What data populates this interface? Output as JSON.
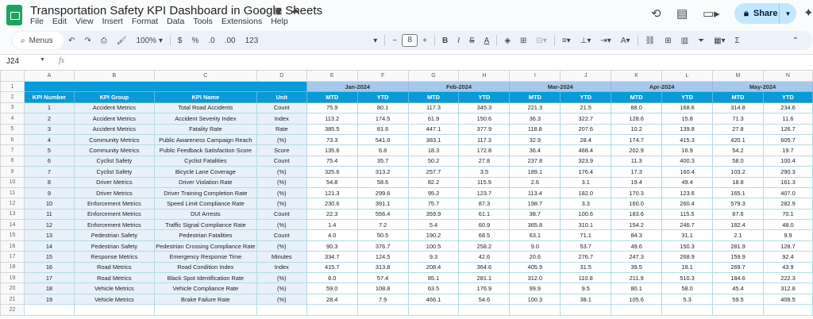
{
  "app": {
    "title": "Transportation Safety KPI Dashboard in Google Sheets",
    "menu": [
      "File",
      "Edit",
      "View",
      "Insert",
      "Format",
      "Data",
      "Tools",
      "Extensions",
      "Help"
    ],
    "share_label": "Share",
    "accent": "#1ea362"
  },
  "toolbar": {
    "search_label": "Menus",
    "zoom": "100%",
    "currency": "$",
    "percent": "%",
    "dec_less": ".0",
    "dec_more": ".00",
    "format_number": "123",
    "font_size": "8"
  },
  "formula_bar": {
    "cell_ref": "J24",
    "value": ""
  },
  "sheet": {
    "columns": [
      "A",
      "B",
      "C",
      "D",
      "E",
      "F",
      "G",
      "H",
      "I",
      "J",
      "K",
      "L",
      "M",
      "N"
    ],
    "selected_column": "J",
    "header_colors": {
      "main": "#0a9ad7",
      "month": "#a8c8ea",
      "label": "#e8f0fa"
    },
    "headers": [
      "KPI Number",
      "KPI Group",
      "KPI Name",
      "Unit"
    ],
    "months": [
      "Jan-2024",
      "Feb-2024",
      "Mar-2024",
      "Apr-2024",
      "May-2024"
    ],
    "sub_headers": [
      "MTD",
      "YTD"
    ],
    "rows": [
      [
        "1",
        "Accident Metrics",
        "Total Road Accidents",
        "Count",
        [
          "75.9",
          "80.1",
          "117.3",
          "345.3",
          "221.3",
          "21.5",
          "88.0",
          "168.6",
          "314.8",
          "234.6"
        ]
      ],
      [
        "2",
        "Accident Metrics",
        "Accident Severity Index",
        "Index",
        [
          "113.2",
          "174.5",
          "61.9",
          "150.6",
          "36.3",
          "322.7",
          "128.6",
          "15.8",
          "71.3",
          "11.6"
        ]
      ],
      [
        "3",
        "Accident Metrics",
        "Fatality Rate",
        "Rate",
        [
          "385.5",
          "81.6",
          "447.1",
          "377.9",
          "118.8",
          "207.6",
          "10.2",
          "139.8",
          "27.8",
          "126.7"
        ]
      ],
      [
        "4",
        "Community Metrics",
        "Public Awareness Campaign Reach",
        "(%)",
        [
          "73.3",
          "541.6",
          "383.1",
          "117.3",
          "32.9",
          "28.4",
          "174.7",
          "415.3",
          "420.1",
          "605.7"
        ]
      ],
      [
        "5",
        "Community Metrics",
        "Public Feedback Satisfaction Score",
        "Score",
        [
          "135.6",
          "6.8",
          "18.3",
          "172.8",
          "36.4",
          "468.4",
          "202.9",
          "16.9",
          "54.2",
          "19.7"
        ]
      ],
      [
        "6",
        "Cyclist Safety",
        "Cyclist Fatalities",
        "Count",
        [
          "75.4",
          "35.7",
          "50.2",
          "27.8",
          "237.8",
          "323.9",
          "11.3",
          "400.3",
          "58.0",
          "100.4"
        ]
      ],
      [
        "7",
        "Cyclist Safety",
        "Bicycle Lane Coverage",
        "(%)",
        [
          "325.6",
          "313.2",
          "257.7",
          "3.5",
          "189.1",
          "176.4",
          "17.3",
          "160.4",
          "103.2",
          "290.3"
        ]
      ],
      [
        "8",
        "Driver Metrics",
        "Driver Violation Rate",
        "(%)",
        [
          "54.8",
          "58.6",
          "82.2",
          "115.9",
          "2.6",
          "3.1",
          "19.4",
          "49.4",
          "18.8",
          "161.3"
        ]
      ],
      [
        "9",
        "Driver Metrics",
        "Driver Training Completion Rate",
        "(%)",
        [
          "121.3",
          "299.6",
          "95.2",
          "123.7",
          "113.4",
          "182.0",
          "170.3",
          "123.6",
          "165.1",
          "407.0"
        ]
      ],
      [
        "10",
        "Enforcement Metrics",
        "Speed Limit Compliance Rate",
        "(%)",
        [
          "230.6",
          "391.1",
          "75.7",
          "87.3",
          "198.7",
          "3.3",
          "160.0",
          "260.4",
          "579.3",
          "282.9"
        ]
      ],
      [
        "11",
        "Enforcement Metrics",
        "DUI Arrests",
        "Count",
        [
          "22.3",
          "556.4",
          "359.9",
          "61.1",
          "38.7",
          "100.6",
          "183.6",
          "115.5",
          "87.6",
          "70.1"
        ]
      ],
      [
        "12",
        "Enforcement Metrics",
        "Traffic Signal Compliance Rate",
        "(%)",
        [
          "1.4",
          "7.2",
          "5.4",
          "60.9",
          "365.8",
          "310.1",
          "154.2",
          "246.7",
          "182.4",
          "48.0"
        ]
      ],
      [
        "13",
        "Pedestrian Safety",
        "Pedestrian Fatalities",
        "Count",
        [
          "4.0",
          "50.5",
          "190.2",
          "68.5",
          "63.1",
          "71.1",
          "84.3",
          "31.1",
          "2.1",
          "9.9"
        ]
      ],
      [
        "14",
        "Pedestrian Safety",
        "Pedestrian Crossing Compliance Rate",
        "(%)",
        [
          "90.3",
          "376.7",
          "100.5",
          "258.2",
          "9.0",
          "53.7",
          "49.6",
          "150.3",
          "281.9",
          "128.7"
        ]
      ],
      [
        "15",
        "Response Metrics",
        "Emergency Response Time",
        "Minutes",
        [
          "334.7",
          "124.5",
          "9.3",
          "42.6",
          "20.6",
          "276.7",
          "247.3",
          "268.9",
          "159.9",
          "92.4"
        ]
      ],
      [
        "16",
        "Road Metrics",
        "Road Condition Index",
        "Index",
        [
          "415.7",
          "313.8",
          "208.4",
          "364.6",
          "405.9",
          "31.5",
          "39.5",
          "18.1",
          "269.7",
          "43.9"
        ]
      ],
      [
        "17",
        "Road Metrics",
        "Black Spot Identification Rate",
        "(%)",
        [
          "8.0",
          "57.4",
          "85.1",
          "281.1",
          "312.0",
          "110.8",
          "211.9",
          "510.3",
          "184.6",
          "222.3"
        ]
      ],
      [
        "18",
        "Vehicle Metrics",
        "Vehicle Compliance Rate",
        "(%)",
        [
          "59.0",
          "108.8",
          "63.5",
          "176.9",
          "99.9",
          "9.5",
          "80.1",
          "58.0",
          "45.4",
          "312.8"
        ]
      ],
      [
        "19",
        "Vehicle Metrics",
        "Brake Failure Rate",
        "(%)",
        [
          "28.4",
          "7.9",
          "466.1",
          "54.6",
          "100.3",
          "38.1",
          "105.6",
          "5.3",
          "59.5",
          "409.5"
        ]
      ]
    ]
  }
}
